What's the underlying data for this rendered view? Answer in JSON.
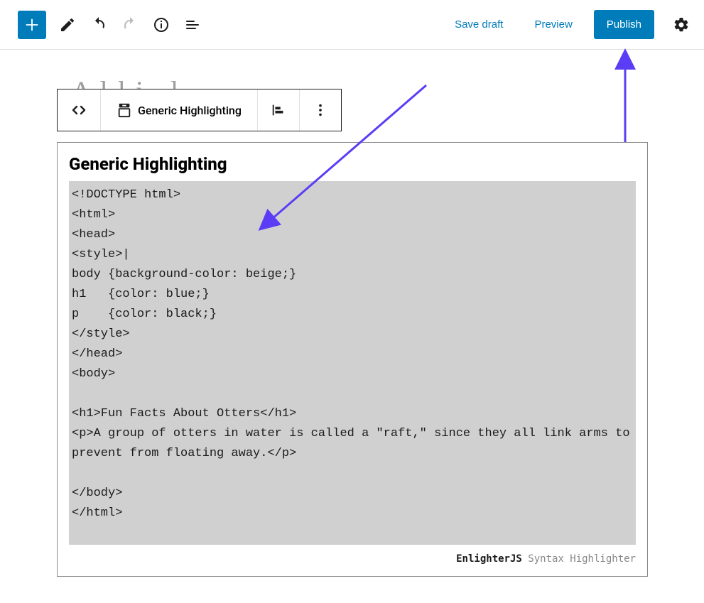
{
  "toolbar": {
    "save_draft": "Save draft",
    "preview": "Preview",
    "publish": "Publish"
  },
  "faded_title": "A  l  l     i  .  l",
  "block_toolbar": {
    "type_label": "Generic Highlighting"
  },
  "block": {
    "title": "Generic Highlighting",
    "code": "<!DOCTYPE html>\n<html>\n<head>\n<style>|\nbody {background-color: beige;}\nh1   {color: blue;}\np    {color: black;}\n</style>\n</head>\n<body>\n\n<h1>Fun Facts About Otters</h1>\n<p>A group of otters in water is called a \"raft,\" since they all link arms to prevent from floating away.</p>\n\n</body>\n</html>",
    "footer_brand": "EnlighterJS",
    "footer_rest": " Syntax Highlighter"
  }
}
